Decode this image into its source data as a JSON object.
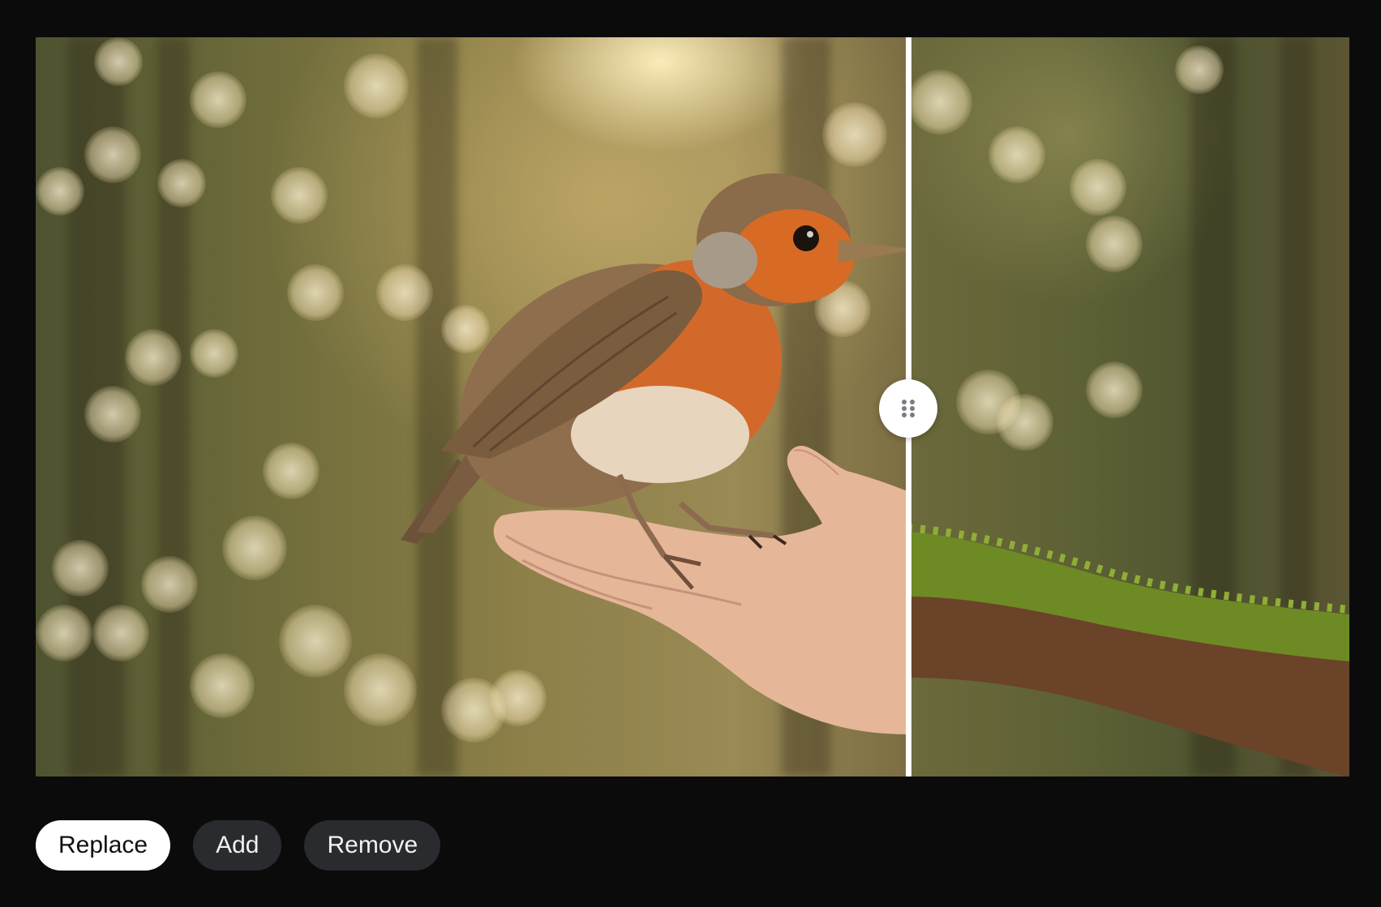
{
  "comparison": {
    "left_image": "robot-bird-on-hand",
    "right_image": "moss-covered-branch",
    "divider_handle_icon": "drag-handle-dots-icon"
  },
  "actions": {
    "items": [
      {
        "label": "Replace",
        "active": true
      },
      {
        "label": "Add",
        "active": false
      },
      {
        "label": "Remove",
        "active": false
      }
    ]
  },
  "colors": {
    "background": "#0b0b0c",
    "active_button": "#ffffff",
    "inactive_button": "#2a2b2e",
    "robin_breast": "#d2692a"
  }
}
